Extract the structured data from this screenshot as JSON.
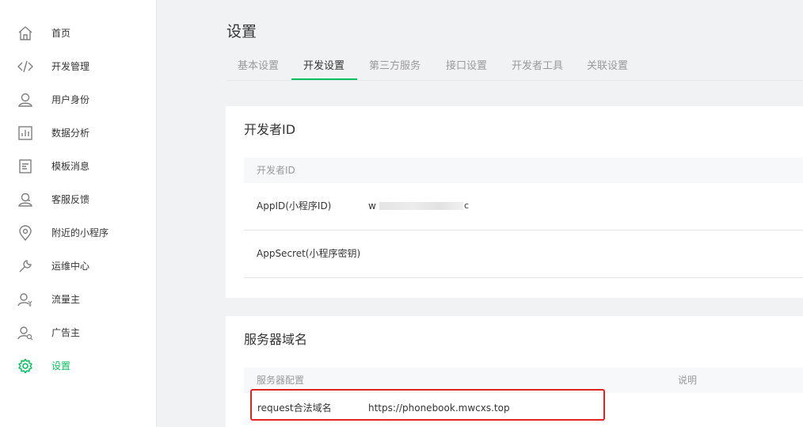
{
  "sidebar": {
    "items": [
      {
        "label": "首页",
        "icon": "home-icon"
      },
      {
        "label": "开发管理",
        "icon": "code-icon"
      },
      {
        "label": "用户身份",
        "icon": "user-icon"
      },
      {
        "label": "数据分析",
        "icon": "bar-chart-icon"
      },
      {
        "label": "模板消息",
        "icon": "document-icon"
      },
      {
        "label": "客服反馈",
        "icon": "customer-service-icon"
      },
      {
        "label": "附近的小程序",
        "icon": "location-pin-icon"
      },
      {
        "label": "运维中心",
        "icon": "wrench-icon"
      },
      {
        "label": "流量主",
        "icon": "user-yen-icon"
      },
      {
        "label": "广告主",
        "icon": "user-search-icon"
      },
      {
        "label": "设置",
        "icon": "gear-icon",
        "active": true
      }
    ],
    "accent_color": "#07c160"
  },
  "main": {
    "title": "设置",
    "tabs": [
      {
        "label": "基本设置"
      },
      {
        "label": "开发设置",
        "active": true
      },
      {
        "label": "第三方服务"
      },
      {
        "label": "接口设置"
      },
      {
        "label": "开发者工具"
      },
      {
        "label": "关联设置"
      }
    ]
  },
  "developer_id": {
    "title": "开发者ID",
    "column_header": "开发者ID",
    "appid_label": "AppID(小程序ID)",
    "appid_prefix": "w",
    "appid_suffix": "c",
    "appsecret_label": "AppSecret(小程序密钥)"
  },
  "server_domain": {
    "title": "服务器域名",
    "column_config": "服务器配置",
    "column_desc": "说明",
    "request_label": "request合法域名",
    "request_value": "https://phonebook.mwcxs.top",
    "highlight_color": "#e02424"
  }
}
